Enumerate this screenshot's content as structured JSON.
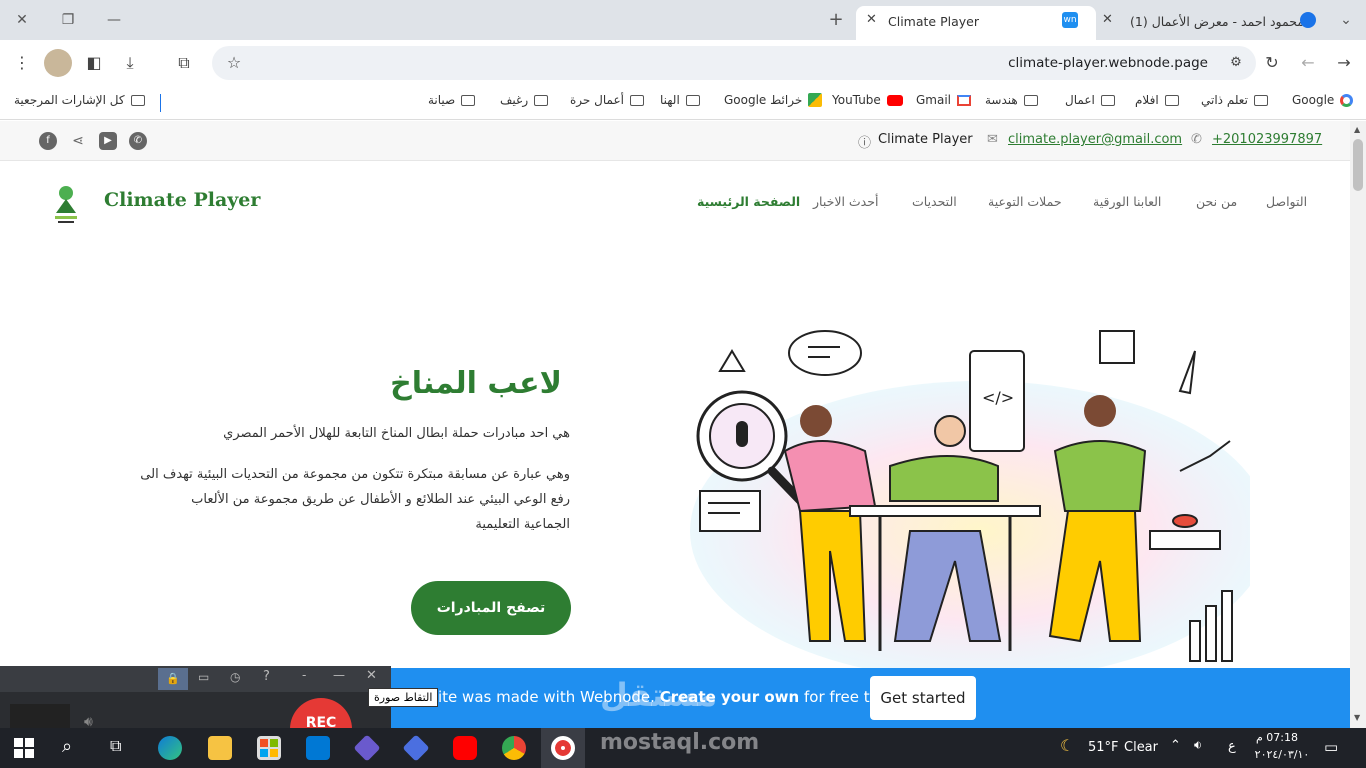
{
  "browser": {
    "tabs": [
      {
        "title": "Climate Player",
        "active": true
      },
      {
        "title": "(1) محمود احمد - معرض الأعمال",
        "active": false
      }
    ],
    "new_tab": "+",
    "url": "climate-player.webnode.page",
    "bookmarks": [
      {
        "label": "Google"
      },
      {
        "label": "تعلم ذاتي"
      },
      {
        "label": "افلام"
      },
      {
        "label": "اعمال"
      },
      {
        "label": "هندسة"
      },
      {
        "label": "Gmail"
      },
      {
        "label": "YouTube"
      },
      {
        "label": "خرائط Google"
      },
      {
        "label": "الهنا"
      },
      {
        "label": "أعمال حرة"
      },
      {
        "label": "رغيف"
      },
      {
        "label": "صيانة"
      }
    ],
    "all_bookmarks": "كل الإشارات المرجعية"
  },
  "site": {
    "topbar": {
      "name": "Climate Player",
      "email": "climate.player@gmail.com",
      "phone": "+201023997897"
    },
    "brand": "Climate Player",
    "nav": [
      {
        "label": "التواصل"
      },
      {
        "label": "من نحن"
      },
      {
        "label": "العابنا الورقية"
      },
      {
        "label": "حملات التوعية"
      },
      {
        "label": "التحديات"
      },
      {
        "label": "أحدث الاخبار"
      },
      {
        "label": "الصفحة الرئيسية",
        "active": true
      }
    ],
    "hero": {
      "title": "لاعب المناخ",
      "p1": "هي احد مبادرات حملة ابطال المناخ التابعة للهلال الأحمر المصري",
      "p2_l1": "وهي عبارة عن مسابقة مبتكرة تتكون من مجموعة من التحديات البيئية تهدف الى",
      "p2_l2": "رفع الوعي البيئي عند الطلائع و الأطفال عن طريق مجموعة من الألعاب",
      "p2_l3": "الجماعية التعليمية",
      "cta": "تصفح المبادرات"
    },
    "banner": {
      "text_pre": "ite was made with Webnode.",
      "text_bold": "Create your own",
      "text_post": "for free today!",
      "button": "Get started"
    }
  },
  "recorder": {
    "tooltip": "التقاط صورة",
    "rec": "REC"
  },
  "taskbar": {
    "weather": "51°F",
    "weather_desc": "Clear",
    "lang": "ع",
    "time": "07:18 م",
    "date": "٢٠٢٤/٠٣/١٠"
  },
  "watermark": {
    "arabic": "مستقل",
    "latin": "mostaql.com"
  },
  "colors": {
    "brand_green": "#2e7d32",
    "banner_blue": "#1f8ff0",
    "taskbar": "#1f2228"
  }
}
